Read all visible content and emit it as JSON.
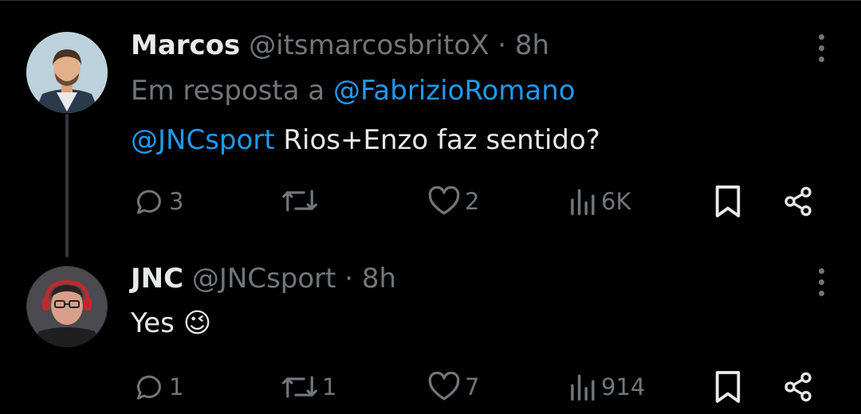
{
  "tweets": [
    {
      "display_name": "Marcos",
      "handle": "@itsmarcosbritoX",
      "separator": "·",
      "time": "8h",
      "reply_prefix": "Em resposta a",
      "reply_to": "@FabrizioRomano",
      "mention": "@JNCsport",
      "text": "Rios+Enzo faz sentido?",
      "replies": "3",
      "retweets": "",
      "likes": "2",
      "views": "6K"
    },
    {
      "display_name": "JNC",
      "handle": "@JNCsport",
      "separator": "·",
      "time": "8h",
      "text": "Yes 😉",
      "replies": "1",
      "retweets": "1",
      "likes": "7",
      "views": "914"
    }
  ],
  "icons": {
    "reply": "reply-icon",
    "retweet": "retweet-icon",
    "like": "heart-icon",
    "views": "views-icon",
    "bookmark": "bookmark-icon",
    "share": "share-icon",
    "more": "more-icon"
  },
  "colors": {
    "background": "#000000",
    "text": "#e7e9ea",
    "secondary": "#71767b",
    "link": "#1d9bf0"
  }
}
